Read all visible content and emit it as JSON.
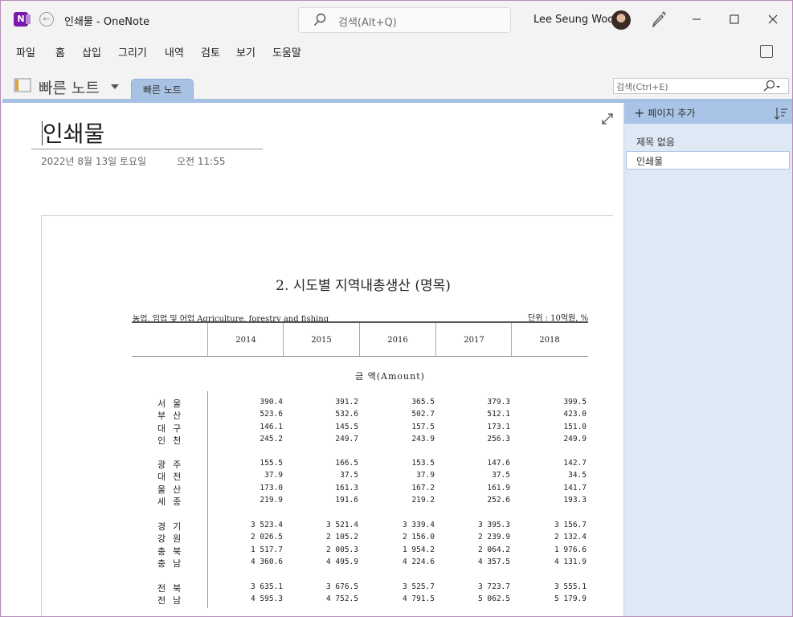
{
  "titlebar": {
    "app_logo": "N",
    "doc_title": "인쇄물  -  OneNote",
    "search_placeholder": "검색(Alt+Q)",
    "user_name": "Lee Seung Woo"
  },
  "menu": [
    "파일",
    "홈",
    "삽입",
    "그리기",
    "내역",
    "검토",
    "보기",
    "도움말"
  ],
  "notebook": {
    "name": "빠른 노트",
    "section_tab": "빠른 노트",
    "page_search_placeholder": "검색(Ctrl+E)"
  },
  "page": {
    "title": "인쇄물",
    "date": "2022년 8월 13일 토요일",
    "time": "오전 11:55"
  },
  "printout": {
    "heading": "2. 시도별 지역내총생산 (명목)",
    "subtitle_left": "농업, 임업 및 어업  Agriculture, forestry and fishing",
    "subtitle_right": "단위 : 10억원, %",
    "years": [
      "2014",
      "2015",
      "2016",
      "2017",
      "2018"
    ],
    "amount_label": "금    액(Amount)",
    "rows": [
      {
        "label": "서울",
        "values": [
          "390.4",
          "391.2",
          "365.5",
          "379.3",
          "399.5"
        ]
      },
      {
        "label": "부산",
        "values": [
          "523.6",
          "532.6",
          "502.7",
          "512.1",
          "423.0"
        ]
      },
      {
        "label": "대구",
        "values": [
          "146.1",
          "145.5",
          "157.5",
          "173.1",
          "151.0"
        ]
      },
      {
        "label": "인천",
        "values": [
          "245.2",
          "249.7",
          "243.9",
          "256.3",
          "249.9"
        ]
      },
      {
        "label": "광주",
        "values": [
          "155.5",
          "166.5",
          "153.5",
          "147.6",
          "142.7"
        ]
      },
      {
        "label": "대전",
        "values": [
          "37.9",
          "37.5",
          "37.9",
          "37.5",
          "34.5"
        ]
      },
      {
        "label": "울산",
        "values": [
          "173.0",
          "161.3",
          "167.2",
          "161.9",
          "141.7"
        ]
      },
      {
        "label": "세종",
        "values": [
          "219.9",
          "191.6",
          "219.2",
          "252.6",
          "193.3"
        ]
      },
      {
        "label": "경기",
        "values": [
          "3 523.4",
          "3 521.4",
          "3 339.4",
          "3 395.3",
          "3 156.7"
        ]
      },
      {
        "label": "강원",
        "values": [
          "2 026.5",
          "2 105.2",
          "2 156.0",
          "2 239.9",
          "2 132.4"
        ]
      },
      {
        "label": "충북",
        "values": [
          "1 517.7",
          "2 005.3",
          "1 954.2",
          "2 064.2",
          "1 976.6"
        ]
      },
      {
        "label": "충남",
        "values": [
          "4 360.6",
          "4 495.9",
          "4 224.6",
          "4 357.5",
          "4 131.9"
        ]
      },
      {
        "label": "전북",
        "values": [
          "3 635.1",
          "3 676.5",
          "3 525.7",
          "3 723.7",
          "3 555.1"
        ]
      },
      {
        "label": "전남",
        "values": [
          "4 595.3",
          "4 752.5",
          "4 791.5",
          "5 062.5",
          "5 179.9"
        ]
      }
    ]
  },
  "pages_pane": {
    "add_page": "페이지 추가",
    "pages": [
      "제목 없음",
      "인쇄물"
    ]
  }
}
